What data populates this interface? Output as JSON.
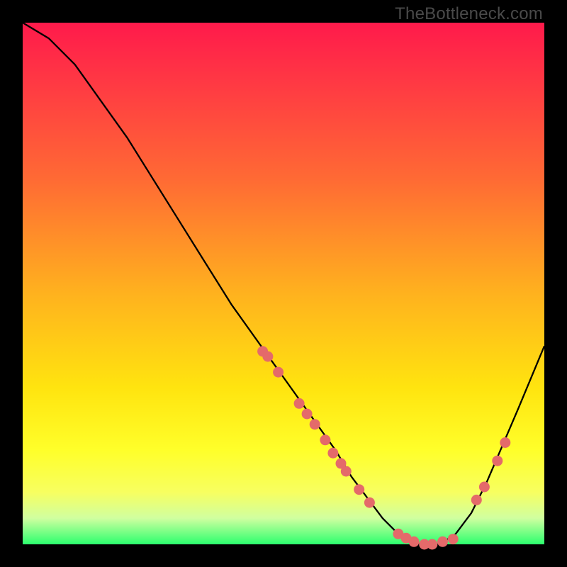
{
  "watermark": "TheBottleneck.com",
  "chart_data": {
    "type": "line",
    "title": "",
    "xlabel": "",
    "ylabel": "",
    "xlim": [
      0,
      100
    ],
    "ylim": [
      0,
      100
    ],
    "grid": false,
    "legend": false,
    "series": [
      {
        "name": "bottleneck-curve",
        "x": [
          0,
          5,
          10,
          15,
          20,
          25,
          30,
          35,
          40,
          45,
          50,
          55,
          60,
          63,
          66,
          69,
          72,
          74,
          76,
          78,
          80,
          83,
          86,
          89,
          92,
          95,
          100
        ],
        "y": [
          100,
          97,
          92,
          85,
          78,
          70,
          62,
          54,
          46,
          39,
          32,
          25,
          18,
          13,
          9,
          5,
          2,
          1,
          0,
          0,
          0,
          2,
          6,
          12,
          19,
          26,
          38
        ]
      }
    ],
    "markers": {
      "groups": [
        {
          "name": "cluster-descent-upper",
          "points_xy": [
            [
              46,
              37
            ],
            [
              47,
              36
            ],
            [
              49,
              33
            ]
          ]
        },
        {
          "name": "cluster-descent-lower",
          "points_xy": [
            [
              53,
              27
            ],
            [
              54.5,
              25
            ],
            [
              56,
              23
            ],
            [
              58,
              20
            ],
            [
              59.5,
              17.5
            ],
            [
              61,
              15.5
            ],
            [
              62,
              14
            ],
            [
              64.5,
              10.5
            ],
            [
              66.5,
              8
            ]
          ]
        },
        {
          "name": "cluster-valley",
          "points_xy": [
            [
              72,
              2
            ],
            [
              73.5,
              1.2
            ],
            [
              75,
              0.5
            ],
            [
              77,
              0
            ],
            [
              78.5,
              0
            ],
            [
              80.5,
              0.5
            ],
            [
              82.5,
              1
            ]
          ]
        },
        {
          "name": "cluster-ascent",
          "points_xy": [
            [
              87,
              8.5
            ],
            [
              88.5,
              11
            ],
            [
              91,
              16
            ],
            [
              92.5,
              19.5
            ]
          ]
        }
      ]
    },
    "colors": {
      "curve": "#000000",
      "marker": "#e46a6a",
      "gradient_top": "#ff1a4b",
      "gradient_mid": "#ffe40f",
      "gradient_bottom": "#2cff6e"
    }
  }
}
